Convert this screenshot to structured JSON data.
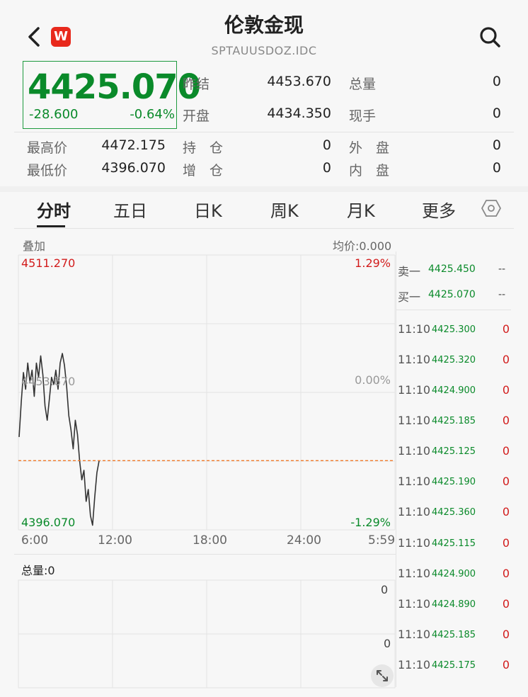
{
  "header": {
    "title": "伦敦金现",
    "code": "SPTAUUSDOZ.IDC",
    "logo": "W",
    "icons": {
      "back": "back-chevron-icon",
      "search": "search-icon",
      "settings": "settings-icon",
      "expand": "expand-icon"
    }
  },
  "quote": {
    "price": "4425.070",
    "change": "-28.600",
    "change_pct": "-0.64%",
    "stats": [
      {
        "label": "昨结",
        "value": "4453.670"
      },
      {
        "label": "开盘",
        "value": "4434.350"
      },
      {
        "label": "总量",
        "value": "0"
      },
      {
        "label": "现手",
        "value": "0"
      },
      {
        "label": "最高价",
        "value": "4472.175"
      },
      {
        "label": "最低价",
        "value": "4396.070"
      },
      {
        "label": "持　仓",
        "value": "0"
      },
      {
        "label": "增　仓",
        "value": "0"
      },
      {
        "label": "外　盘",
        "value": "0"
      },
      {
        "label": "内　盘",
        "value": "0"
      }
    ]
  },
  "tabs": [
    "分时",
    "五日",
    "日K",
    "周K",
    "月K",
    "更多"
  ],
  "chart": {
    "overlay_label": "叠加",
    "avg_label": "均价:0.000",
    "max_price": "4511.270",
    "mid_price": "4453.670",
    "min_price": "4396.070",
    "max_pct": "1.29%",
    "mid_pct": "0.00%",
    "min_pct": "-1.29%",
    "time_labels": [
      "6:00",
      "12:00",
      "18:00",
      "24:00",
      "5:59"
    ],
    "volume_label": "总量:0",
    "vol_max": "0",
    "vol_mid": "0"
  },
  "orderbook": {
    "sell_label": "卖一",
    "sell_price": "4425.450",
    "sell_vol": "--",
    "buy_label": "买一",
    "buy_price": "4425.070",
    "buy_vol": "--"
  },
  "ticks": [
    {
      "time": "11:10",
      "price": "4425.300",
      "vol": "0"
    },
    {
      "time": "11:10",
      "price": "4425.320",
      "vol": "0"
    },
    {
      "time": "11:10",
      "price": "4424.900",
      "vol": "0"
    },
    {
      "time": "11:10",
      "price": "4425.185",
      "vol": "0"
    },
    {
      "time": "11:10",
      "price": "4425.125",
      "vol": "0"
    },
    {
      "time": "11:10",
      "price": "4425.190",
      "vol": "0"
    },
    {
      "time": "11:10",
      "price": "4425.360",
      "vol": "0"
    },
    {
      "time": "11:10",
      "price": "4425.115",
      "vol": "0"
    },
    {
      "time": "11:10",
      "price": "4424.900",
      "vol": "0"
    },
    {
      "time": "11:10",
      "price": "4424.890",
      "vol": "0"
    },
    {
      "time": "11:10",
      "price": "4425.185",
      "vol": "0"
    },
    {
      "time": "11:10",
      "price": "4425.175",
      "vol": "0"
    }
  ],
  "colors": {
    "up": "#d21c1c",
    "down": "#0a8a2a",
    "line": "#333333",
    "current_line": "#f07a2a"
  }
}
